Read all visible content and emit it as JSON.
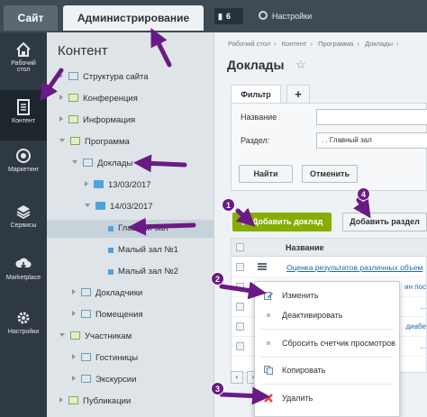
{
  "topbar": {
    "tab_site": "Сайт",
    "tab_admin": "Администрирование",
    "notifications_count": "6",
    "settings_label": "Настройки"
  },
  "sidebar": {
    "items": [
      {
        "label_line1": "Рабочий",
        "label_line2": "стол",
        "icon": "home-icon"
      },
      {
        "label_line1": "Контент",
        "label_line2": "",
        "icon": "document-icon"
      },
      {
        "label_line1": "Маркетинг",
        "label_line2": "",
        "icon": "target-icon"
      },
      {
        "label_line1": "Сервисы",
        "label_line2": "",
        "icon": "layers-icon"
      },
      {
        "label_line1": "Marketplace",
        "label_line2": "",
        "icon": "cloud-download-icon"
      },
      {
        "label_line1": "Настройки",
        "label_line2": "",
        "icon": "gear-icon"
      }
    ]
  },
  "tree": {
    "title": "Контент",
    "nodes": [
      {
        "label": "Структура сайта"
      },
      {
        "label": "Конференция"
      },
      {
        "label": "Информация"
      },
      {
        "label": "Программа"
      },
      {
        "label": "Доклады"
      },
      {
        "label": "13/03/2017"
      },
      {
        "label": "14/03/2017"
      },
      {
        "label": "Главный зал"
      },
      {
        "label": "Малый зал №1"
      },
      {
        "label": "Малый зал №2"
      },
      {
        "label": "Докладчики"
      },
      {
        "label": "Помещения"
      },
      {
        "label": "Участникам"
      },
      {
        "label": "Гостиницы"
      },
      {
        "label": "Экскурсии"
      },
      {
        "label": "Публикации"
      }
    ]
  },
  "main": {
    "breadcrumbs": [
      "Рабочий стол",
      "›",
      "Контент",
      "›",
      "Программа",
      "›",
      "Доклады",
      "›"
    ],
    "title": "Доклады",
    "filter_tab": "Фильтр",
    "add_tab": "+",
    "filter": {
      "name_label": "Название",
      "name_value": "",
      "section_label": "Раздел:",
      "section_value": ". . Главный зал",
      "find_button": "Найти",
      "cancel_button": "Отменить"
    },
    "add_report_button": "Добавить доклад",
    "add_section_button": "Добавить раздел",
    "grid": {
      "column_name": "Название",
      "rows": [
        {
          "title": "Оценка результатов различных объем"
        },
        {
          "title": "",
          "tail": "ин пос"
        },
        {
          "title": "",
          "tail": "..."
        },
        {
          "title": "",
          "tail": "диабе"
        },
        {
          "title": "",
          "tail": "..."
        }
      ]
    }
  },
  "context_menu": {
    "items": [
      {
        "label": "Изменить",
        "icon": "edit-icon"
      },
      {
        "label": "Деактивировать",
        "icon": "bullet-icon"
      },
      {
        "label": "Сбросить счетчик просмотров",
        "icon": "bullet-icon"
      },
      {
        "label": "Копировать",
        "icon": "copy-icon"
      },
      {
        "label": "Удалить",
        "icon": "delete-icon"
      }
    ]
  },
  "annotations": {
    "badges": [
      "1",
      "2",
      "3",
      "4"
    ],
    "color": "#6a1a86"
  },
  "colors": {
    "topbar": "#3e4a54",
    "sidebar": "#2f3943",
    "accent_green": "#86ad00",
    "link": "#2067b0"
  }
}
